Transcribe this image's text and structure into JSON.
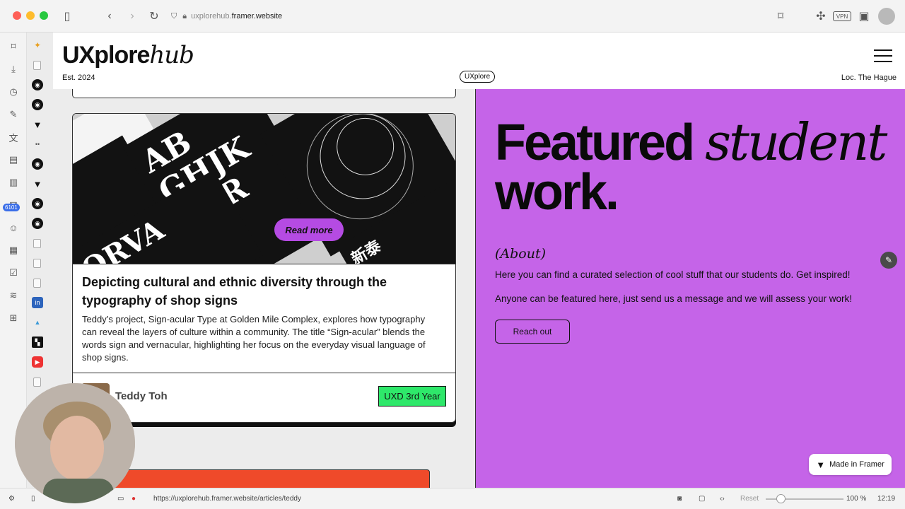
{
  "browser": {
    "url_prefix": "uxplorehub.",
    "url_domain": "framer.website",
    "vpn_label": "VPN"
  },
  "sidebar": {
    "badge": "6101"
  },
  "site": {
    "logo_main": "UXplore",
    "logo_italic": "hub",
    "est": "Est. 2024",
    "center_pill": "UXplore",
    "location": "Loc. The Hague"
  },
  "card": {
    "read_more": "Read more",
    "title": "Depicting cultural and ethnic diversity through the typography of shop signs",
    "body": "Teddy’s project, Sign-acular Type at Golden Mile Complex, explores how typography can reveal the layers of culture within a community. The title “Sign-acular” blends the words sign and vernacular, highlighting her focus on the everyday visual language of shop signs.",
    "author": "Teddy Toh",
    "tag": "UXD 3rd Year"
  },
  "featured": {
    "heading_a": "Featured ",
    "heading_italic": "student",
    "heading_b": "work.",
    "about": "(About)",
    "para1": "Here you can find a curated selection of cool stuff that our students do. Get inspired!",
    "para2": "Anyone can be featured here, just send us a message and we will assess your work!",
    "reach_out": "Reach out",
    "made_in_framer": "Made in Framer"
  },
  "status": {
    "link_url": "https://uxplorehub.framer.website/articles/teddy",
    "reset": "Reset",
    "zoom": "100 %",
    "time": "12:19"
  },
  "colors": {
    "accent_purple": "#c564e8",
    "tag_green": "#2ee86a",
    "read_more_purple": "#b54be3"
  }
}
